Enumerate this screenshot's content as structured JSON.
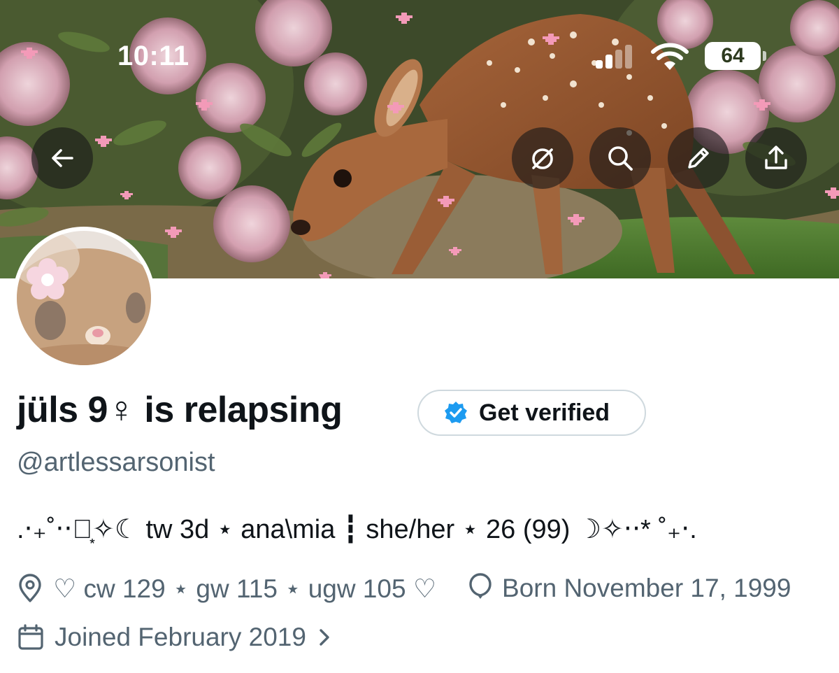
{
  "status_bar": {
    "time": "10:11",
    "battery": "64"
  },
  "header_actions": {
    "back": "back-arrow-icon",
    "actions": [
      "link-off-icon",
      "search-icon",
      "pencil-icon",
      "share-icon"
    ]
  },
  "profile": {
    "display_name": "jüls 9♀ is relapsing",
    "verify_label": "Get verified",
    "handle": "@artlessarsonist",
    "bio": ".‧₊˚‧‧‧͙✧☾ tw 3d ⋆ ana\\mia ┇ she/her ⋆ 26 (99) ☽✧‧‧* ˚₊‧.",
    "location": "♡ cw 129 ⋆ gw 115 ⋆ ugw 105 ♡",
    "born": "Born November 17, 1999",
    "joined": "Joined February 2019"
  },
  "colors": {
    "secondary_text": "#536471",
    "verified_blue": "#1d9bf0",
    "border": "#cfd9de"
  }
}
